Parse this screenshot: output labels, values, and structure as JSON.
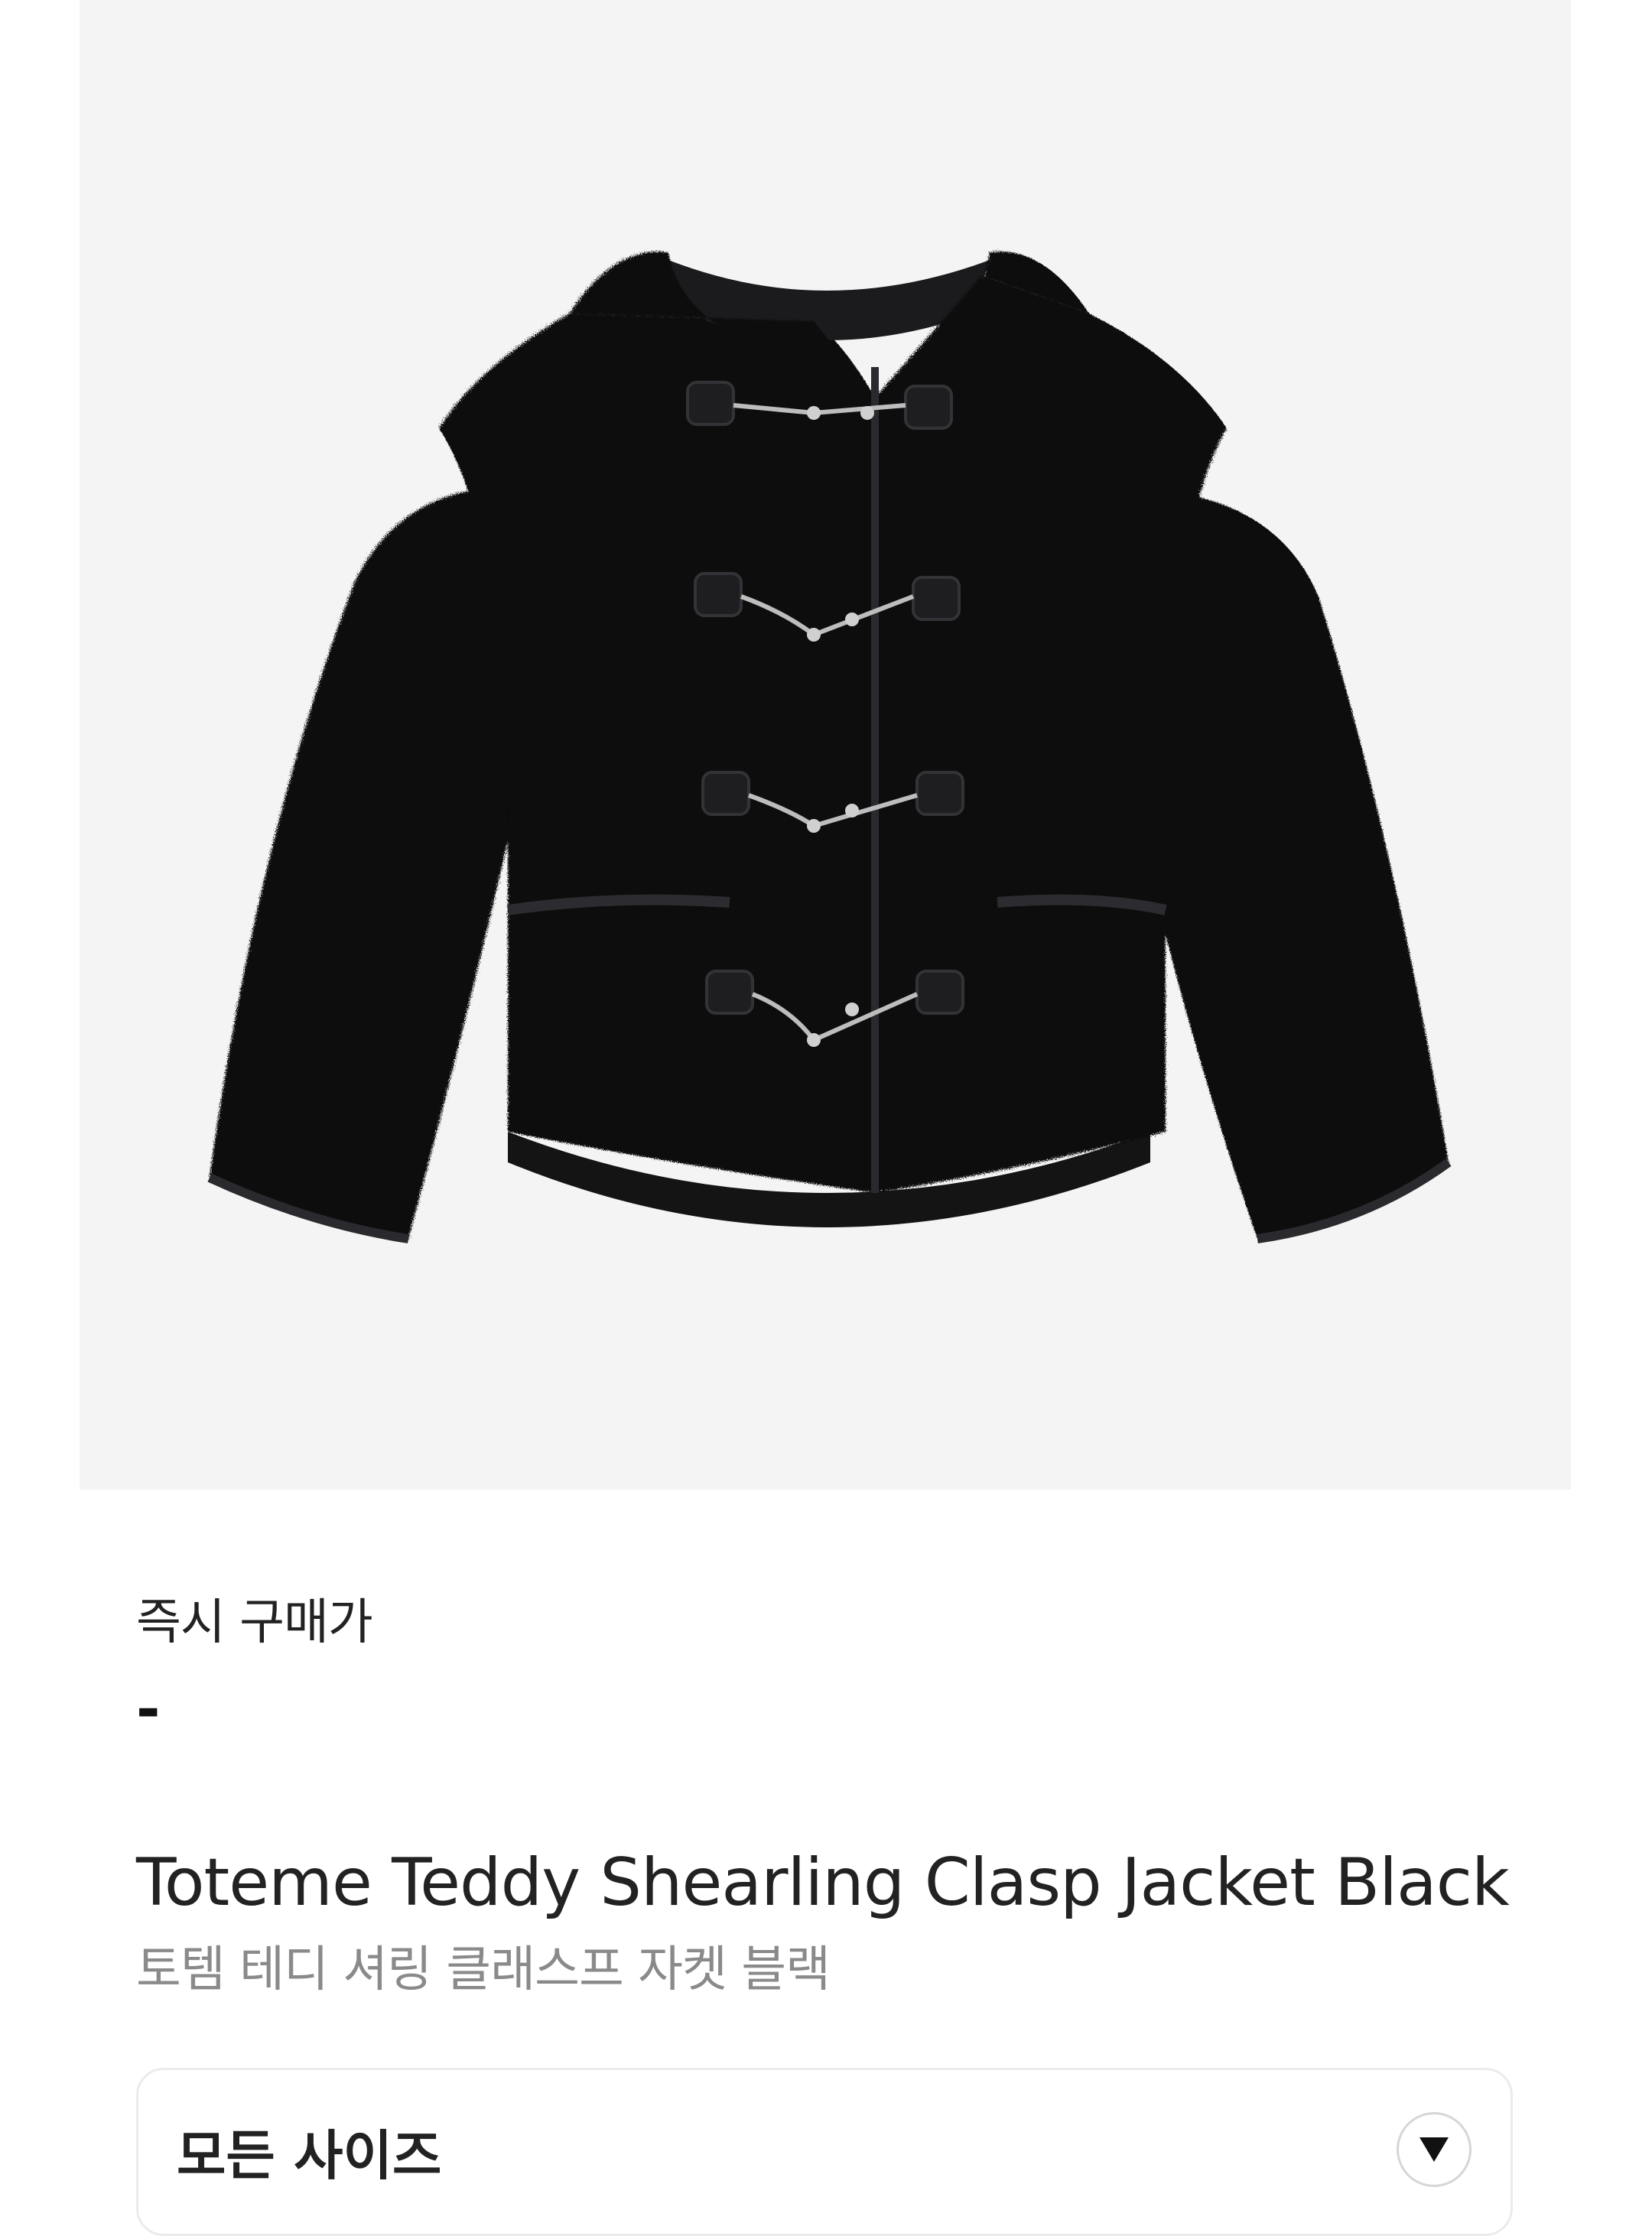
{
  "product": {
    "image_alt": "Toteme Teddy Shearling Clasp Jacket Black",
    "image_background": "#f4f4f4"
  },
  "price": {
    "label": "즉시 구매가",
    "value": "-"
  },
  "title": {
    "en": "Toteme Teddy Shearling Clasp Jacket Black",
    "ko": "토템 테디 셔링 클래스프 자켓 블랙"
  },
  "size_selector": {
    "value": "모든 사이즈",
    "icon": "chevron-down-icon"
  }
}
